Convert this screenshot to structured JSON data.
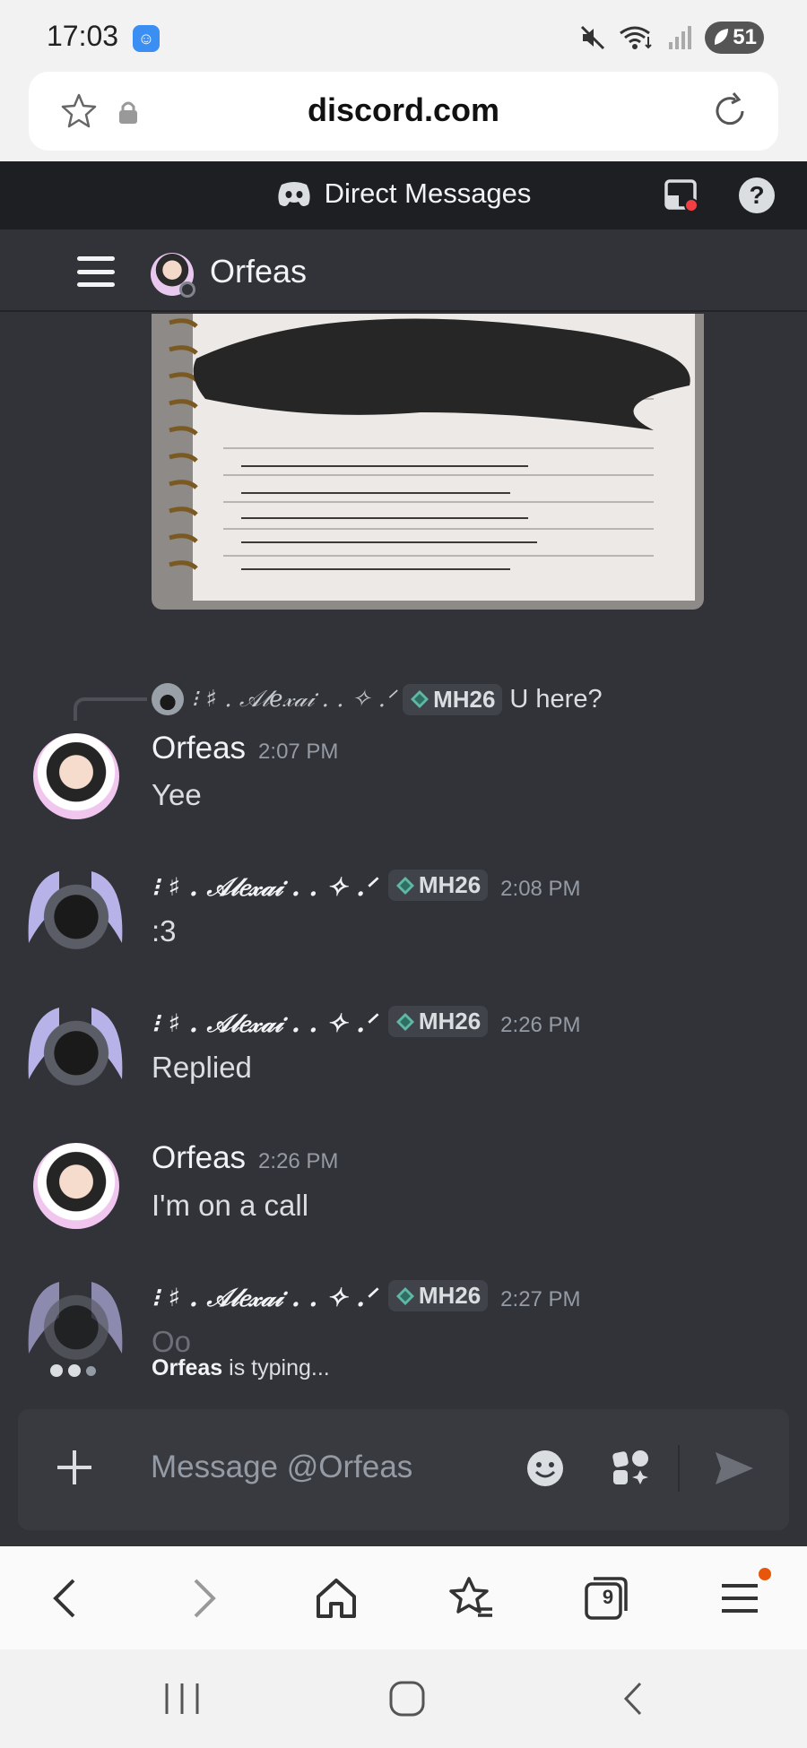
{
  "status_bar": {
    "time": "17:03",
    "battery": "51"
  },
  "browser": {
    "url": "discord.com",
    "tabs_count": "9"
  },
  "discord": {
    "header_title": "Direct Messages",
    "help_label": "?",
    "channel_name": "Orfeas"
  },
  "reply_preview": {
    "author": "⁝ ♯ . 𝒜𝓁𝑒𝓍𝒶𝒾 . . ✧ .ᐟ",
    "tag": "MH26",
    "text": "U here?"
  },
  "messages": [
    {
      "author": "Orfeas",
      "time": "2:07 PM",
      "text": "Yee"
    },
    {
      "author": "⁝ ♯ . 𝒜𝓁𝑒𝓍𝒶𝒾 . . ✧ .ᐟ",
      "tag": "MH26",
      "time": "2:08 PM",
      "text": ":3"
    },
    {
      "author": "⁝ ♯ . 𝒜𝓁𝑒𝓍𝒶𝒾 . . ✧ .ᐟ",
      "tag": "MH26",
      "time": "2:26 PM",
      "text": "Replied"
    },
    {
      "author": "Orfeas",
      "time": "2:26 PM",
      "text": "I'm on a call"
    },
    {
      "author": "⁝ ♯ . 𝒜𝓁𝑒𝓍𝒶𝒾 . . ✧ .ᐟ",
      "tag": "MH26",
      "time": "2:27 PM",
      "text": "Oo"
    }
  ],
  "typing": {
    "user": "Orfeas",
    "suffix": " is typing..."
  },
  "composer": {
    "placeholder": "Message @Orfeas"
  },
  "icons": {
    "status": [
      "app-notification-icon",
      "mute-icon",
      "wifi-icon",
      "signal-icon",
      "battery-icon"
    ],
    "url_bar": [
      "star-icon",
      "lock-icon",
      "reload-icon"
    ],
    "discord": [
      "discord-logo-icon",
      "inbox-icon",
      "help-icon",
      "hamburger-icon"
    ],
    "composer": [
      "plus-icon",
      "emoji-icon",
      "apps-icon",
      "send-icon"
    ],
    "browser_nav": [
      "back-icon",
      "forward-icon",
      "home-icon",
      "bookmarks-icon",
      "tabs-icon",
      "menu-icon"
    ],
    "system_nav": [
      "recent-apps-icon",
      "home-icon",
      "back-icon"
    ]
  },
  "colors": {
    "discord_bg": "#313338",
    "discord_header": "#1e1f22",
    "composer_bg": "#383a40",
    "text_primary": "#f2f3f5",
    "text_muted": "#949ba4",
    "tag_bg": "#41434a",
    "notification_dot": "#e8560c"
  }
}
